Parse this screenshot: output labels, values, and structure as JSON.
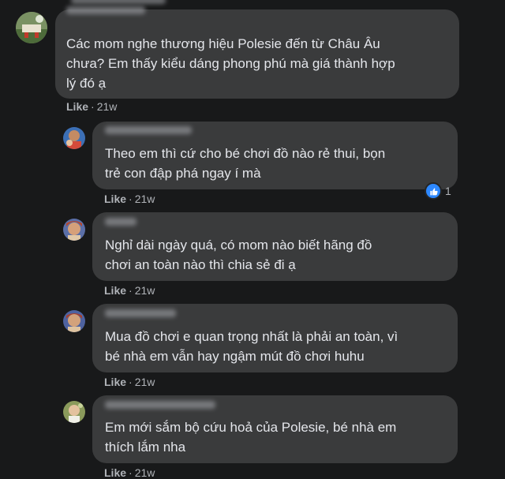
{
  "comments": [
    {
      "text": "Các mom nghe thương hiệu Polesie đến từ Châu Âu\nchưa? Em thấy kiểu dáng phong phú mà giá thành hợp\nlý đó ạ",
      "like_label": "Like",
      "time": "21w"
    },
    {
      "text": "Theo em thì cứ cho bé chơi đồ nào rẻ thui, bọn\ntrẻ con đập phá ngay í mà",
      "like_label": "Like",
      "time": "21w",
      "reaction_count": "1"
    },
    {
      "text": "Nghỉ dài ngày quá, có mom nào biết hãng đồ\nchơi an toàn nào thì chia sẻ đi ạ",
      "like_label": "Like",
      "time": "21w"
    },
    {
      "text": "Mua đồ chơi e quan trọng nhất là phải an toàn, vì\nbé nhà em vẫn hay ngậm mút đồ chơi huhu",
      "like_label": "Like",
      "time": "21w"
    },
    {
      "text": "Em mới sắm bộ cứu hoả của Polesie, bé nhà em\nthích lắm nha",
      "like_label": "Like",
      "time": "21w"
    }
  ],
  "colors": {
    "background": "#18191a",
    "bubble": "#3a3b3c",
    "text": "#e4e6eb",
    "meta": "#b0b3b8",
    "like_badge": "#2d88ff"
  },
  "icons": {
    "reaction": "thumbs-up-icon"
  }
}
